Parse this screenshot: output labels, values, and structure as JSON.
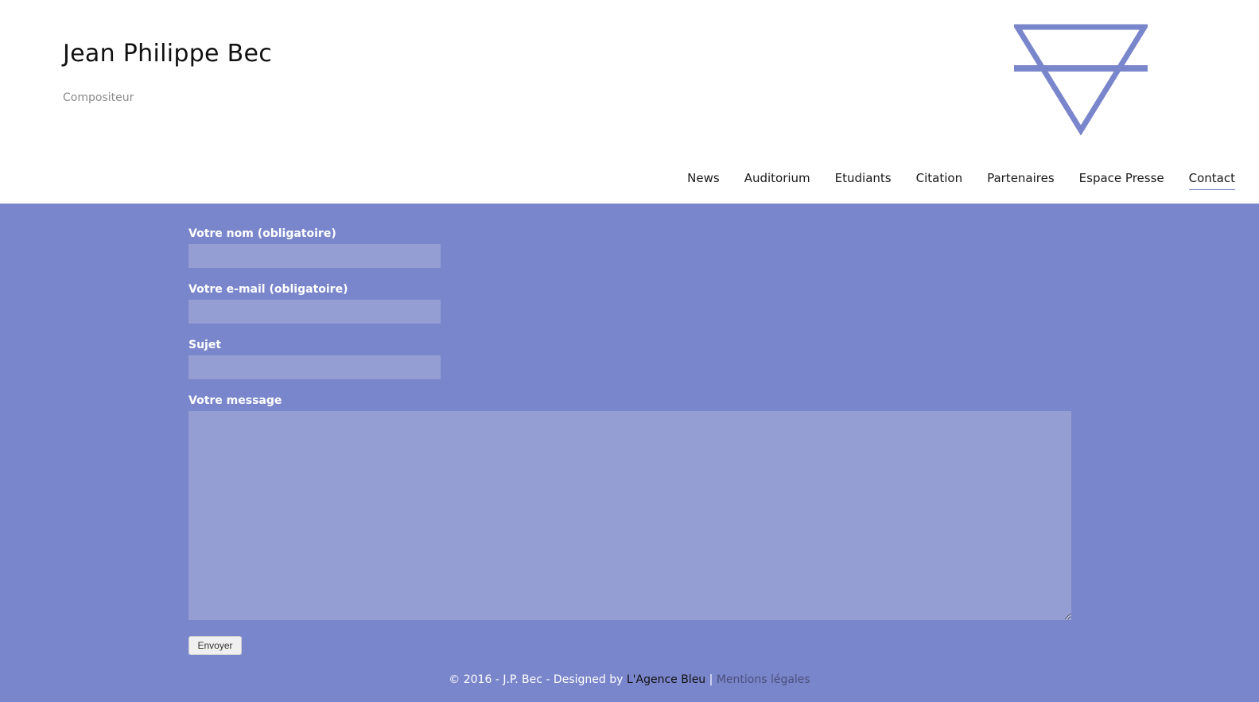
{
  "header": {
    "title": "Jean Philippe Bec",
    "tagline": "Compositeur",
    "logo_icon": "alchemical-earth-triangle-icon",
    "logo_color": "#7a86cb"
  },
  "nav": {
    "items": [
      {
        "label": "News"
      },
      {
        "label": "Auditorium"
      },
      {
        "label": "Etudiants"
      },
      {
        "label": "Citation"
      },
      {
        "label": "Partenaires"
      },
      {
        "label": "Espace Presse"
      },
      {
        "label": "Contact",
        "active": true
      }
    ]
  },
  "form": {
    "name_label": "Votre nom (obligatoire)",
    "name_value": "",
    "email_label": "Votre e-mail (obligatoire)",
    "email_value": "",
    "subject_label": "Sujet",
    "subject_value": "",
    "message_label": "Votre message",
    "message_value": "",
    "submit_label": "Envoyer"
  },
  "footer": {
    "copyright": "© 2016 - J.P. Bec - Designed by ",
    "agency_link": "L'Agence Bleu",
    "separator": " | ",
    "legal_link": "Mentions légales"
  },
  "colors": {
    "background": "#7a86cb",
    "input_background": "#949ed3",
    "header_background": "#ffffff"
  }
}
